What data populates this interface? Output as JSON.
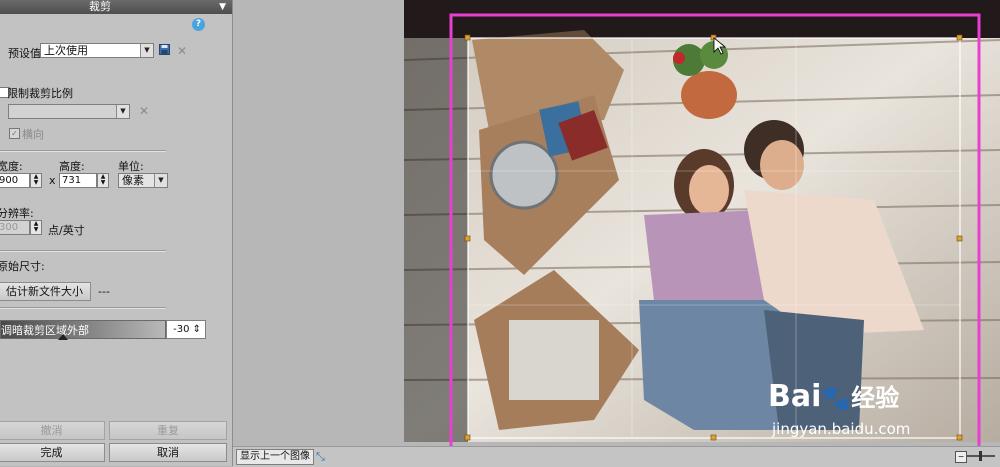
{
  "panel": {
    "title": "裁剪",
    "help_label": "?",
    "preset_label": "预设值",
    "preset_value": "上次使用",
    "constrain_label": "限制裁剪比例",
    "landscape_label": "横向",
    "width_label": "宽度:",
    "height_label": "高度:",
    "unit_label": "单位:",
    "width_value": "900",
    "times": "x",
    "height_value": "731",
    "unit_value": "像素",
    "resolution_label": "分辨率:",
    "resolution_value": "300",
    "resolution_unit": "点/英寸",
    "original_size_label": "原始尺寸:",
    "estimate_button": "估计新文件大小",
    "estimate_value": "---",
    "darken_label": "调暗裁剪区域外部",
    "darken_value": "-30",
    "undo_button": "撤消",
    "redo_button": "重复",
    "done_button": "完成",
    "cancel_button": "取消"
  },
  "bottom": {
    "show_previous_button": "显示上一个图像"
  },
  "watermark": {
    "brand": "Bai",
    "brand_cn": "经验",
    "url": "jingyan.baidu.com"
  },
  "colors": {
    "crop_outline": "#e83fd0",
    "crop_frame": "#ffffff",
    "handle": "#e0a030"
  }
}
